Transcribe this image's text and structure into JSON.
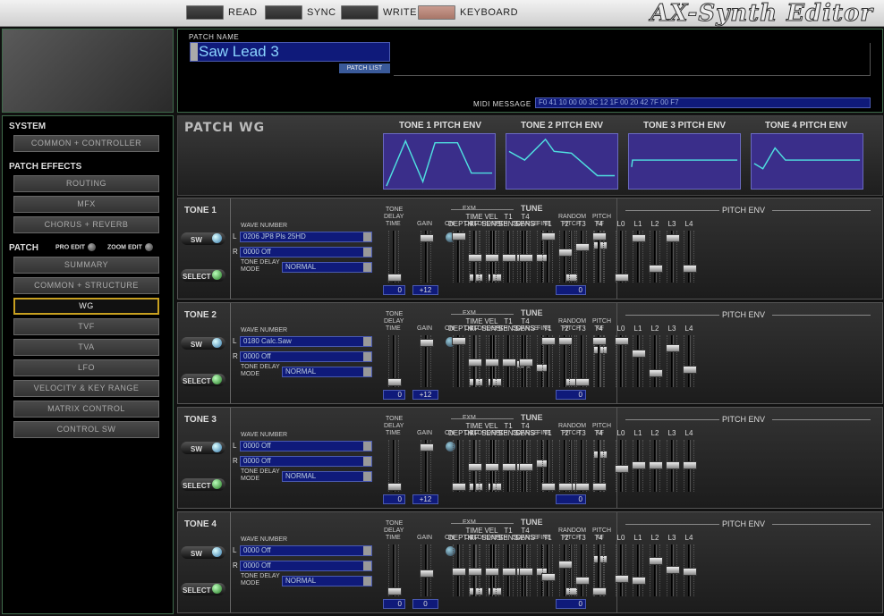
{
  "topbar": {
    "read": "READ",
    "sync": "SYNC",
    "write": "WRITE",
    "keyboard": "KEYBOARD",
    "logo": "AX-Synth Editor"
  },
  "patch": {
    "name_label": "PATCH NAME",
    "name": "Saw Lead 3",
    "patch_list": "PATCH LIST",
    "midi_label": "MIDI MESSAGE",
    "midi": "F0 41 10 00 00 3C 12 1F 00 20 42 7F 00 F7"
  },
  "sidebar": {
    "system": "SYSTEM",
    "common_controller": "COMMON + CONTROLLER",
    "patch_effects": "PATCH EFFECTS",
    "routing": "ROUTING",
    "mfx": "MFX",
    "chorus_reverb": "CHORUS + REVERB",
    "patch": "PATCH",
    "pro_edit": "PRO EDIT",
    "zoom_edit": "ZOOM EDIT",
    "summary": "SUMMARY",
    "common_structure": "COMMON + STRUCTURE",
    "wg": "WG",
    "tvf": "TVF",
    "tva": "TVA",
    "lfo": "LFO",
    "velocity": "VELOCITY & KEY RANGE",
    "matrix": "MATRIX CONTROL",
    "control_sw": "CONTROL SW"
  },
  "wg": {
    "title": "PATCH WG",
    "env1": "TONE 1 PITCH ENV",
    "env2": "TONE 2 PITCH ENV",
    "env3": "TONE 3 PITCH ENV",
    "env4": "TONE 4 PITCH ENV"
  },
  "labels": {
    "sw": "SW",
    "select": "SELECT",
    "wave_number": "WAVE NUMBER",
    "l": "L",
    "r": "R",
    "tdm1": "TONE DELAY",
    "tdm2": "MODE",
    "tdt1": "TONE",
    "tdt2": "DELAY",
    "tdt3": "TIME",
    "gain": "GAIN",
    "fxm": "FXM",
    "on": "ON",
    "color": "COLOR",
    "depth": "DEPTH",
    "tune": "TUNE",
    "coarse": "COARSE",
    "fine": "FINE",
    "random1": "RANDOM",
    "random2": "PITCH",
    "pitch1": "PITCH",
    "pitch2": "KF",
    "pitch_env": "PITCH ENV",
    "pe_depth": "DEPTH",
    "pe_time1": "TIME",
    "pe_time2": "KF",
    "pe_vel1": "VEL",
    "pe_vel2": "SENS",
    "pe_t1s1": "T1",
    "pe_t1s2": "SENS",
    "pe_t4s1": "T4",
    "pe_t4s2": "SENS",
    "t1": "T1",
    "t2": "T2",
    "t3": "T3",
    "t4": "T4",
    "l0": "L0",
    "l1": "L1",
    "l2": "L2",
    "l3": "L3",
    "l4": "L4"
  },
  "tones": [
    {
      "name": "TONE 1",
      "wave_l": "0206 JP8 Pls 25HD",
      "wave_r": "0000 Off",
      "mode": "NORMAL",
      "delay": "0",
      "gain": "+12",
      "random": "0"
    },
    {
      "name": "TONE 2",
      "wave_l": "0180 Calc.Saw",
      "wave_r": "0000 Off",
      "mode": "NORMAL",
      "delay": "0",
      "gain": "+12",
      "random": "0"
    },
    {
      "name": "TONE 3",
      "wave_l": "0000 Off",
      "wave_r": "0000 Off",
      "mode": "NORMAL",
      "delay": "0",
      "gain": "+12",
      "random": "0"
    },
    {
      "name": "TONE 4",
      "wave_l": "0000 Off",
      "wave_r": "0000 Off",
      "mode": "NORMAL",
      "delay": "0",
      "gain": "0",
      "random": "0"
    }
  ]
}
